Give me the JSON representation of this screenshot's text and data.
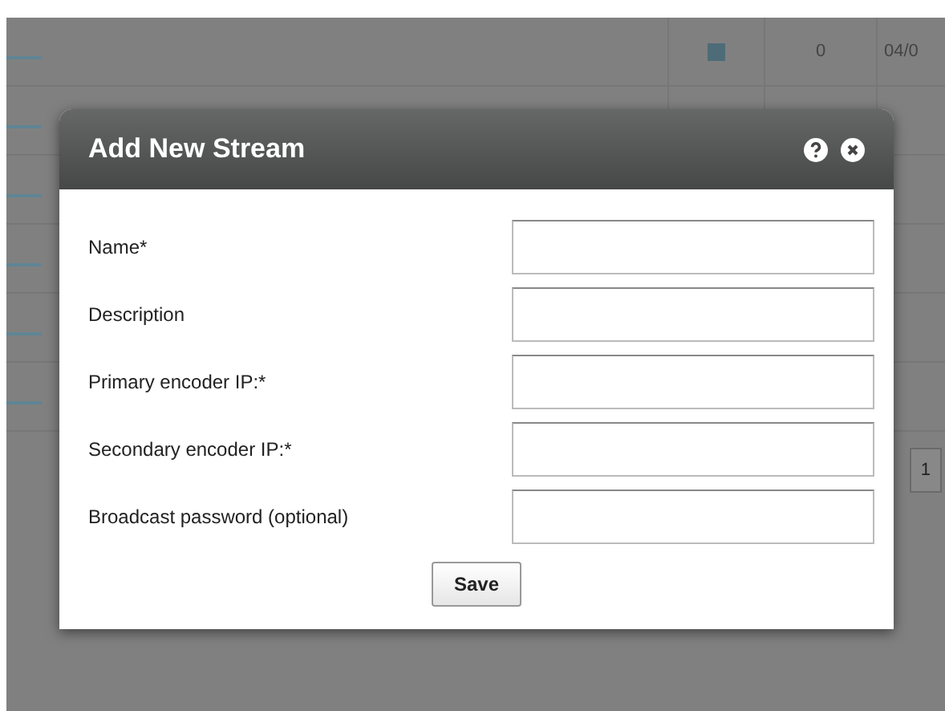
{
  "background": {
    "first_row": {
      "count": "0",
      "date": "04/0"
    },
    "pager": "1"
  },
  "dialog": {
    "title": "Add New Stream",
    "fields": [
      {
        "label": "Name*"
      },
      {
        "label": "Description"
      },
      {
        "label": "Primary encoder IP:*"
      },
      {
        "label": "Secondary encoder IP:*"
      },
      {
        "label": "Broadcast password (optional)"
      }
    ],
    "save": "Save"
  }
}
